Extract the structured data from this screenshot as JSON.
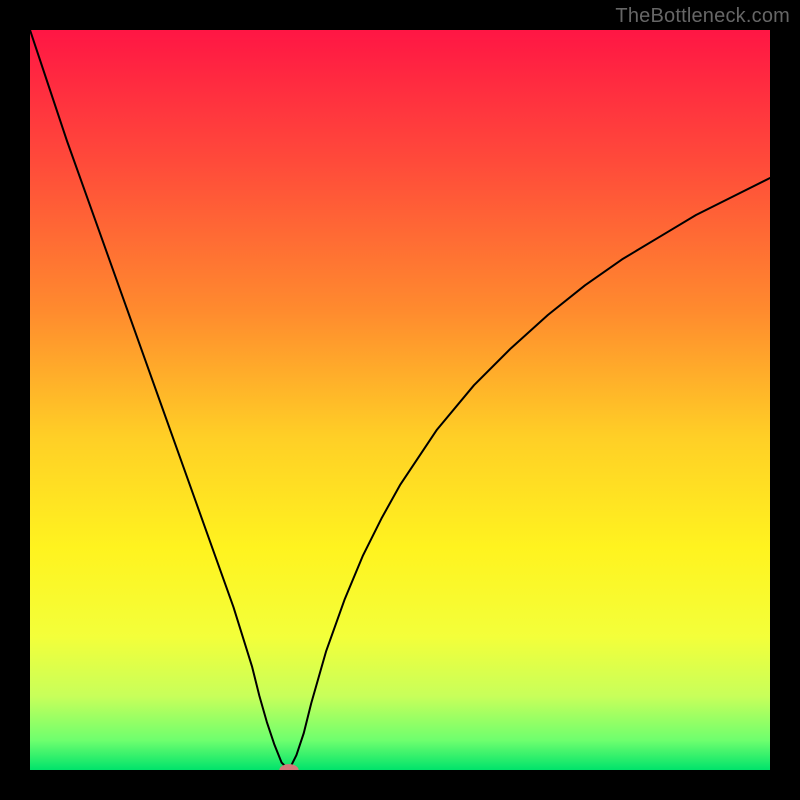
{
  "watermark": "TheBottleneck.com",
  "chart_data": {
    "type": "line",
    "title": "",
    "xlabel": "",
    "ylabel": "",
    "xlim": [
      0,
      100
    ],
    "ylim": [
      0,
      100
    ],
    "grid": false,
    "legend": false,
    "gradient_top_color": "#ff1a4d",
    "gradient_bottom_color": "#00e36b",
    "gradient_stops": [
      {
        "offset": 0.0,
        "color": "#ff1644"
      },
      {
        "offset": 0.18,
        "color": "#ff4b3a"
      },
      {
        "offset": 0.38,
        "color": "#ff8b2e"
      },
      {
        "offset": 0.55,
        "color": "#ffcf26"
      },
      {
        "offset": 0.7,
        "color": "#fff31f"
      },
      {
        "offset": 0.82,
        "color": "#f3ff3a"
      },
      {
        "offset": 0.9,
        "color": "#c8ff5a"
      },
      {
        "offset": 0.96,
        "color": "#6eff6e"
      },
      {
        "offset": 1.0,
        "color": "#00e36b"
      }
    ],
    "curve": {
      "min_at_x": 35,
      "x": [
        0,
        2.5,
        5,
        7.5,
        10,
        12.5,
        15,
        17.5,
        20,
        22.5,
        25,
        27.5,
        30,
        31,
        32,
        33,
        34,
        35,
        36,
        37,
        38,
        40,
        42.5,
        45,
        47.5,
        50,
        55,
        60,
        65,
        70,
        75,
        80,
        85,
        90,
        95,
        100
      ],
      "y": [
        100,
        92.5,
        85,
        78,
        71,
        64,
        57,
        50,
        43,
        36,
        29,
        22,
        14,
        10,
        6.5,
        3.5,
        1,
        0,
        2,
        5,
        9,
        16,
        23,
        29,
        34,
        38.5,
        46,
        52,
        57,
        61.5,
        65.5,
        69,
        72,
        75,
        77.5,
        80
      ]
    },
    "marker": {
      "x": 35,
      "y": 0,
      "rx": 1.3,
      "ry": 0.8,
      "fill": "#d27a7a"
    }
  }
}
